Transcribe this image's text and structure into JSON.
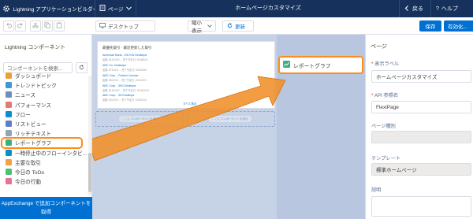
{
  "topbar": {
    "app_name": "Lightning アプリケーションビルダー",
    "page_menu": "ページ",
    "page_title": "ホームページカスタマイズ",
    "back": "戻る",
    "help": "ヘルプ"
  },
  "toolbar": {
    "view_mode": "デスクトップ",
    "display_mode": "縮小表示",
    "refresh": "更新",
    "save": "保存",
    "activate": "有効化..."
  },
  "left_panel": {
    "title": "Lightning コンポーネント",
    "search_placeholder": "コンポーネントを検索...",
    "components": [
      {
        "label": "ダッシュボード",
        "color": "#e8a23d"
      },
      {
        "label": "トレンドトピック",
        "color": "#3c97dd"
      },
      {
        "label": "ニュース",
        "color": "#6d8fbf"
      },
      {
        "label": "パフォーマンス",
        "color": "#e37b72"
      },
      {
        "label": "フロー",
        "color": "#0b8ecb"
      },
      {
        "label": "リストビュー",
        "color": "#5e7ec8"
      },
      {
        "label": "リッチテキスト",
        "color": "#94a4b7"
      },
      {
        "label": "レポートグラフ",
        "color": "#3bb07b"
      },
      {
        "label": "一時停止中のフローインタビ...",
        "color": "#0b8ecb"
      },
      {
        "label": "主要な取引",
        "color": "#f5a142"
      },
      {
        "label": "今日の ToDo",
        "color": "#4bc076"
      },
      {
        "label": "今日の行動",
        "color": "#eb7092"
      }
    ],
    "appexchange_line1": "AppExchange で追加コンポーネントを",
    "appexchange_line2": "取得"
  },
  "canvas": {
    "card_title": "最優先取引 - 最近更新した取引",
    "rows": [
      {
        "name": "American Bank - 100 KW Desktops",
        "sub": "金額: $100,000 ... 完了予定日: 2016/8/31"
      },
      {
        "name": "ABC Co. Desktops",
        "sub": "金額: $75,000 ... 完了予定日: 2016/9/20"
      },
      {
        "name": "ABC Corp. - Partner License",
        "sub": "金額: $50,000 ... 完了予定日: 2016/10/1"
      },
      {
        "name": "ABC Corp. - 500 Desktops",
        "sub": "金額: $150,000 ... 完了予定日: 2016/10/11"
      },
      {
        "name": "ABC Corp. - 50 Desktops",
        "sub": "金額: $20,000 ... 完了予定日: 2016/11/3"
      }
    ],
    "more": "すべて表示",
    "add_component_left": "ここにコンポーネントを追加",
    "add_component_right": "ここにコンポーネントを追加",
    "dropped_component": "レポートグラフ"
  },
  "right_panel": {
    "title": "ページ",
    "label_field": "表示ラベル",
    "label_value": "ホームページカスタマイズ",
    "api_field": "API 参照名",
    "api_value": "FlexiPage",
    "type_field": "ページ種別",
    "type_value": "",
    "template_field": "テンプレート",
    "template_value": "標準ホームページ",
    "description_field": "説明"
  }
}
